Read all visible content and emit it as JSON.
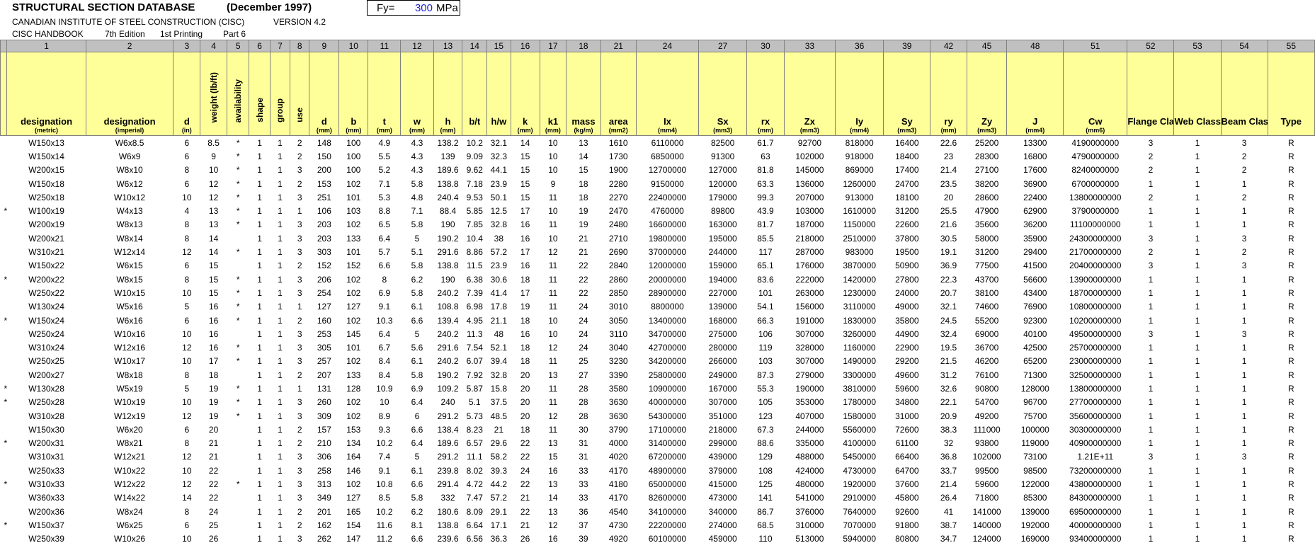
{
  "header": {
    "title": "STRUCTURAL SECTION DATABASE",
    "date": "(December 1997)",
    "org": "CANADIAN INSTITUTE OF STEEL CONSTRUCTION (CISC)",
    "version": "VERSION 4.2",
    "handbook": "CISC HANDBOOK",
    "edition": "7th Edition",
    "printing": "1st Printing",
    "part": "Part 6"
  },
  "fy": {
    "label": "Fy=",
    "value": "300",
    "unit": "MPa"
  },
  "columns": [
    {
      "num": "",
      "label": "",
      "unit": "",
      "w": 9
    },
    {
      "num": "1",
      "label": "designation",
      "unit": "(metric)",
      "w": 106
    },
    {
      "num": "2",
      "label": "designation",
      "unit": "(imperial)",
      "w": 118
    },
    {
      "num": "3",
      "label": "d",
      "unit": "(in)",
      "w": 36
    },
    {
      "num": "4",
      "label": "weight (lb/ft)",
      "unit": "",
      "w": 36,
      "v": true
    },
    {
      "num": "5",
      "label": "availability",
      "unit": "",
      "w": 30,
      "v": true
    },
    {
      "num": "6",
      "label": "shape",
      "unit": "",
      "w": 28,
      "v": true
    },
    {
      "num": "7",
      "label": "group",
      "unit": "",
      "w": 27,
      "v": true
    },
    {
      "num": "8",
      "label": "use",
      "unit": "",
      "w": 26,
      "v": true
    },
    {
      "num": "9",
      "label": "d",
      "unit": "(mm)",
      "w": 40
    },
    {
      "num": "10",
      "label": "b",
      "unit": "(mm)",
      "w": 39
    },
    {
      "num": "11",
      "label": "t",
      "unit": "(mm)",
      "w": 44
    },
    {
      "num": "12",
      "label": "w",
      "unit": "(mm)",
      "w": 44
    },
    {
      "num": "13",
      "label": "h",
      "unit": "(mm)",
      "w": 39
    },
    {
      "num": "14",
      "label": "b/t",
      "unit": "",
      "w": 33
    },
    {
      "num": "15",
      "label": "h/w",
      "unit": "",
      "w": 32
    },
    {
      "num": "16",
      "label": "k",
      "unit": "(mm)",
      "w": 39
    },
    {
      "num": "17",
      "label": "k1",
      "unit": "(mm)",
      "w": 36
    },
    {
      "num": "18",
      "label": "mass",
      "unit": "(kg/m)",
      "w": 46
    },
    {
      "num": "21",
      "label": "area",
      "unit": "(mm2)",
      "w": 48
    },
    {
      "num": "24",
      "label": "Ix",
      "unit": "(mm4)",
      "w": 84
    },
    {
      "num": "27",
      "label": "Sx",
      "unit": "(mm3)",
      "w": 65
    },
    {
      "num": "30",
      "label": "rx",
      "unit": "(mm)",
      "w": 50
    },
    {
      "num": "33",
      "label": "Zx",
      "unit": "(mm3)",
      "w": 69
    },
    {
      "num": "36",
      "label": "Iy",
      "unit": "(mm4)",
      "w": 65
    },
    {
      "num": "39",
      "label": "Sy",
      "unit": "(mm3)",
      "w": 63
    },
    {
      "num": "42",
      "label": "ry",
      "unit": "(mm)",
      "w": 49
    },
    {
      "num": "45",
      "label": "Zy",
      "unit": "(mm3)",
      "w": 54
    },
    {
      "num": "48",
      "label": "J",
      "unit": "(mm4)",
      "w": 76
    },
    {
      "num": "51",
      "label": "Cw",
      "unit": "(mm6)",
      "w": 86
    },
    {
      "num": "52",
      "label": "Flange Class",
      "unit": "",
      "w": 63
    },
    {
      "num": "53",
      "label": "Web Class",
      "unit": "",
      "w": 63
    },
    {
      "num": "54",
      "label": "Beam Class",
      "unit": "",
      "w": 63
    },
    {
      "num": "55",
      "label": "Type",
      "unit": "",
      "w": 63
    }
  ],
  "rows": [
    [
      "",
      "W150x13",
      "W6x8.5",
      "6",
      "8.5",
      "*",
      "1",
      "1",
      "2",
      "148",
      "100",
      "4.9",
      "4.3",
      "138.2",
      "10.2",
      "32.1",
      "14",
      "10",
      "13",
      "1610",
      "6110000",
      "82500",
      "61.7",
      "92700",
      "818000",
      "16400",
      "22.6",
      "25200",
      "13300",
      "4190000000",
      "3",
      "1",
      "3",
      "R"
    ],
    [
      "",
      "W150x14",
      "W6x9",
      "6",
      "9",
      "*",
      "1",
      "1",
      "2",
      "150",
      "100",
      "5.5",
      "4.3",
      "139",
      "9.09",
      "32.3",
      "15",
      "10",
      "14",
      "1730",
      "6850000",
      "91300",
      "63",
      "102000",
      "918000",
      "18400",
      "23",
      "28300",
      "16800",
      "4790000000",
      "2",
      "1",
      "2",
      "R"
    ],
    [
      "",
      "W200x15",
      "W8x10",
      "8",
      "10",
      "*",
      "1",
      "1",
      "3",
      "200",
      "100",
      "5.2",
      "4.3",
      "189.6",
      "9.62",
      "44.1",
      "15",
      "10",
      "15",
      "1900",
      "12700000",
      "127000",
      "81.8",
      "145000",
      "869000",
      "17400",
      "21.4",
      "27100",
      "17600",
      "8240000000",
      "2",
      "1",
      "2",
      "R"
    ],
    [
      "",
      "W150x18",
      "W6x12",
      "6",
      "12",
      "*",
      "1",
      "1",
      "2",
      "153",
      "102",
      "7.1",
      "5.8",
      "138.8",
      "7.18",
      "23.9",
      "15",
      "9",
      "18",
      "2280",
      "9150000",
      "120000",
      "63.3",
      "136000",
      "1260000",
      "24700",
      "23.5",
      "38200",
      "36900",
      "6700000000",
      "1",
      "1",
      "1",
      "R"
    ],
    [
      "",
      "W250x18",
      "W10x12",
      "10",
      "12",
      "*",
      "1",
      "1",
      "3",
      "251",
      "101",
      "5.3",
      "4.8",
      "240.4",
      "9.53",
      "50.1",
      "15",
      "11",
      "18",
      "2270",
      "22400000",
      "179000",
      "99.3",
      "207000",
      "913000",
      "18100",
      "20",
      "28600",
      "22400",
      "13800000000",
      "2",
      "1",
      "2",
      "R"
    ],
    [
      "*",
      "W100x19",
      "W4x13",
      "4",
      "13",
      "*",
      "1",
      "1",
      "1",
      "106",
      "103",
      "8.8",
      "7.1",
      "88.4",
      "5.85",
      "12.5",
      "17",
      "10",
      "19",
      "2470",
      "4760000",
      "89800",
      "43.9",
      "103000",
      "1610000",
      "31200",
      "25.5",
      "47900",
      "62900",
      "3790000000",
      "1",
      "1",
      "1",
      "R"
    ],
    [
      "",
      "W200x19",
      "W8x13",
      "8",
      "13",
      "*",
      "1",
      "1",
      "3",
      "203",
      "102",
      "6.5",
      "5.8",
      "190",
      "7.85",
      "32.8",
      "16",
      "11",
      "19",
      "2480",
      "16600000",
      "163000",
      "81.7",
      "187000",
      "1150000",
      "22600",
      "21.6",
      "35600",
      "36200",
      "11100000000",
      "1",
      "1",
      "1",
      "R"
    ],
    [
      "",
      "W200x21",
      "W8x14",
      "8",
      "14",
      "",
      "1",
      "1",
      "3",
      "203",
      "133",
      "6.4",
      "5",
      "190.2",
      "10.4",
      "38",
      "16",
      "10",
      "21",
      "2710",
      "19800000",
      "195000",
      "85.5",
      "218000",
      "2510000",
      "37800",
      "30.5",
      "58000",
      "35900",
      "24300000000",
      "3",
      "1",
      "3",
      "R"
    ],
    [
      "",
      "W310x21",
      "W12x14",
      "12",
      "14",
      "*",
      "1",
      "1",
      "3",
      "303",
      "101",
      "5.7",
      "5.1",
      "291.6",
      "8.86",
      "57.2",
      "17",
      "12",
      "21",
      "2690",
      "37000000",
      "244000",
      "117",
      "287000",
      "983000",
      "19500",
      "19.1",
      "31200",
      "29400",
      "21700000000",
      "2",
      "1",
      "2",
      "R"
    ],
    [
      "",
      "W150x22",
      "W6x15",
      "6",
      "15",
      "",
      "1",
      "1",
      "2",
      "152",
      "152",
      "6.6",
      "5.8",
      "138.8",
      "11.5",
      "23.9",
      "16",
      "11",
      "22",
      "2840",
      "12000000",
      "159000",
      "65.1",
      "176000",
      "3870000",
      "50900",
      "36.9",
      "77500",
      "41500",
      "20400000000",
      "3",
      "1",
      "3",
      "R"
    ],
    [
      "*",
      "W200x22",
      "W8x15",
      "8",
      "15",
      "*",
      "1",
      "1",
      "3",
      "206",
      "102",
      "8",
      "6.2",
      "190",
      "6.38",
      "30.6",
      "18",
      "11",
      "22",
      "2860",
      "20000000",
      "194000",
      "83.6",
      "222000",
      "1420000",
      "27800",
      "22.3",
      "43700",
      "56600",
      "13900000000",
      "1",
      "1",
      "1",
      "R"
    ],
    [
      "",
      "W250x22",
      "W10x15",
      "10",
      "15",
      "*",
      "1",
      "1",
      "3",
      "254",
      "102",
      "6.9",
      "5.8",
      "240.2",
      "7.39",
      "41.4",
      "17",
      "11",
      "22",
      "2850",
      "28900000",
      "227000",
      "101",
      "263000",
      "1230000",
      "24000",
      "20.7",
      "38100",
      "43400",
      "18700000000",
      "1",
      "1",
      "1",
      "R"
    ],
    [
      "",
      "W130x24",
      "W5x16",
      "5",
      "16",
      "*",
      "1",
      "1",
      "1",
      "127",
      "127",
      "9.1",
      "6.1",
      "108.8",
      "6.98",
      "17.8",
      "19",
      "11",
      "24",
      "3010",
      "8800000",
      "139000",
      "54.1",
      "156000",
      "3110000",
      "49000",
      "32.1",
      "74600",
      "76900",
      "10800000000",
      "1",
      "1",
      "1",
      "R"
    ],
    [
      "*",
      "W150x24",
      "W6x16",
      "6",
      "16",
      "*",
      "1",
      "1",
      "2",
      "160",
      "102",
      "10.3",
      "6.6",
      "139.4",
      "4.95",
      "21.1",
      "18",
      "10",
      "24",
      "3050",
      "13400000",
      "168000",
      "66.3",
      "191000",
      "1830000",
      "35800",
      "24.5",
      "55200",
      "92300",
      "10200000000",
      "1",
      "1",
      "1",
      "R"
    ],
    [
      "",
      "W250x24",
      "W10x16",
      "10",
      "16",
      "",
      "1",
      "1",
      "3",
      "253",
      "145",
      "6.4",
      "5",
      "240.2",
      "11.3",
      "48",
      "16",
      "10",
      "24",
      "3110",
      "34700000",
      "275000",
      "106",
      "307000",
      "3260000",
      "44900",
      "32.4",
      "69000",
      "40100",
      "49500000000",
      "3",
      "1",
      "3",
      "R"
    ],
    [
      "",
      "W310x24",
      "W12x16",
      "12",
      "16",
      "*",
      "1",
      "1",
      "3",
      "305",
      "101",
      "6.7",
      "5.6",
      "291.6",
      "7.54",
      "52.1",
      "18",
      "12",
      "24",
      "3040",
      "42700000",
      "280000",
      "119",
      "328000",
      "1160000",
      "22900",
      "19.5",
      "36700",
      "42500",
      "25700000000",
      "1",
      "1",
      "1",
      "R"
    ],
    [
      "",
      "W250x25",
      "W10x17",
      "10",
      "17",
      "*",
      "1",
      "1",
      "3",
      "257",
      "102",
      "8.4",
      "6.1",
      "240.2",
      "6.07",
      "39.4",
      "18",
      "11",
      "25",
      "3230",
      "34200000",
      "266000",
      "103",
      "307000",
      "1490000",
      "29200",
      "21.5",
      "46200",
      "65200",
      "23000000000",
      "1",
      "1",
      "1",
      "R"
    ],
    [
      "",
      "W200x27",
      "W8x18",
      "8",
      "18",
      "",
      "1",
      "1",
      "2",
      "207",
      "133",
      "8.4",
      "5.8",
      "190.2",
      "7.92",
      "32.8",
      "20",
      "13",
      "27",
      "3390",
      "25800000",
      "249000",
      "87.3",
      "279000",
      "3300000",
      "49600",
      "31.2",
      "76100",
      "71300",
      "32500000000",
      "1",
      "1",
      "1",
      "R"
    ],
    [
      "*",
      "W130x28",
      "W5x19",
      "5",
      "19",
      "*",
      "1",
      "1",
      "1",
      "131",
      "128",
      "10.9",
      "6.9",
      "109.2",
      "5.87",
      "15.8",
      "20",
      "11",
      "28",
      "3580",
      "10900000",
      "167000",
      "55.3",
      "190000",
      "3810000",
      "59600",
      "32.6",
      "90800",
      "128000",
      "13800000000",
      "1",
      "1",
      "1",
      "R"
    ],
    [
      "*",
      "W250x28",
      "W10x19",
      "10",
      "19",
      "*",
      "1",
      "1",
      "3",
      "260",
      "102",
      "10",
      "6.4",
      "240",
      "5.1",
      "37.5",
      "20",
      "11",
      "28",
      "3630",
      "40000000",
      "307000",
      "105",
      "353000",
      "1780000",
      "34800",
      "22.1",
      "54700",
      "96700",
      "27700000000",
      "1",
      "1",
      "1",
      "R"
    ],
    [
      "",
      "W310x28",
      "W12x19",
      "12",
      "19",
      "*",
      "1",
      "1",
      "3",
      "309",
      "102",
      "8.9",
      "6",
      "291.2",
      "5.73",
      "48.5",
      "20",
      "12",
      "28",
      "3630",
      "54300000",
      "351000",
      "123",
      "407000",
      "1580000",
      "31000",
      "20.9",
      "49200",
      "75700",
      "35600000000",
      "1",
      "1",
      "1",
      "R"
    ],
    [
      "",
      "W150x30",
      "W6x20",
      "6",
      "20",
      "",
      "1",
      "1",
      "2",
      "157",
      "153",
      "9.3",
      "6.6",
      "138.4",
      "8.23",
      "21",
      "18",
      "11",
      "30",
      "3790",
      "17100000",
      "218000",
      "67.3",
      "244000",
      "5560000",
      "72600",
      "38.3",
      "111000",
      "100000",
      "30300000000",
      "1",
      "1",
      "1",
      "R"
    ],
    [
      "*",
      "W200x31",
      "W8x21",
      "8",
      "21",
      "",
      "1",
      "1",
      "2",
      "210",
      "134",
      "10.2",
      "6.4",
      "189.6",
      "6.57",
      "29.6",
      "22",
      "13",
      "31",
      "4000",
      "31400000",
      "299000",
      "88.6",
      "335000",
      "4100000",
      "61100",
      "32",
      "93800",
      "119000",
      "40900000000",
      "1",
      "1",
      "1",
      "R"
    ],
    [
      "",
      "W310x31",
      "W12x21",
      "12",
      "21",
      "",
      "1",
      "1",
      "3",
      "306",
      "164",
      "7.4",
      "5",
      "291.2",
      "11.1",
      "58.2",
      "22",
      "15",
      "31",
      "4020",
      "67200000",
      "439000",
      "129",
      "488000",
      "5450000",
      "66400",
      "36.8",
      "102000",
      "73100",
      "1.21E+11",
      "3",
      "1",
      "3",
      "R"
    ],
    [
      "",
      "W250x33",
      "W10x22",
      "10",
      "22",
      "",
      "1",
      "1",
      "3",
      "258",
      "146",
      "9.1",
      "6.1",
      "239.8",
      "8.02",
      "39.3",
      "24",
      "16",
      "33",
      "4170",
      "48900000",
      "379000",
      "108",
      "424000",
      "4730000",
      "64700",
      "33.7",
      "99500",
      "98500",
      "73200000000",
      "1",
      "1",
      "1",
      "R"
    ],
    [
      "*",
      "W310x33",
      "W12x22",
      "12",
      "22",
      "*",
      "1",
      "1",
      "3",
      "313",
      "102",
      "10.8",
      "6.6",
      "291.4",
      "4.72",
      "44.2",
      "22",
      "13",
      "33",
      "4180",
      "65000000",
      "415000",
      "125",
      "480000",
      "1920000",
      "37600",
      "21.4",
      "59600",
      "122000",
      "43800000000",
      "1",
      "1",
      "1",
      "R"
    ],
    [
      "",
      "W360x33",
      "W14x22",
      "14",
      "22",
      "",
      "1",
      "1",
      "3",
      "349",
      "127",
      "8.5",
      "5.8",
      "332",
      "7.47",
      "57.2",
      "21",
      "14",
      "33",
      "4170",
      "82600000",
      "473000",
      "141",
      "541000",
      "2910000",
      "45800",
      "26.4",
      "71800",
      "85300",
      "84300000000",
      "1",
      "1",
      "1",
      "R"
    ],
    [
      "",
      "W200x36",
      "W8x24",
      "8",
      "24",
      "",
      "1",
      "1",
      "2",
      "201",
      "165",
      "10.2",
      "6.2",
      "180.6",
      "8.09",
      "29.1",
      "22",
      "13",
      "36",
      "4540",
      "34100000",
      "340000",
      "86.7",
      "376000",
      "7640000",
      "92600",
      "41",
      "141000",
      "139000",
      "69500000000",
      "1",
      "1",
      "1",
      "R"
    ],
    [
      "*",
      "W150x37",
      "W6x25",
      "6",
      "25",
      "",
      "1",
      "1",
      "2",
      "162",
      "154",
      "11.6",
      "8.1",
      "138.8",
      "6.64",
      "17.1",
      "21",
      "12",
      "37",
      "4730",
      "22200000",
      "274000",
      "68.5",
      "310000",
      "7070000",
      "91800",
      "38.7",
      "140000",
      "192000",
      "40000000000",
      "1",
      "1",
      "1",
      "R"
    ],
    [
      "",
      "W250x39",
      "W10x26",
      "10",
      "26",
      "",
      "1",
      "1",
      "3",
      "262",
      "147",
      "11.2",
      "6.6",
      "239.6",
      "6.56",
      "36.3",
      "26",
      "16",
      "39",
      "4920",
      "60100000",
      "459000",
      "110",
      "513000",
      "5940000",
      "80800",
      "34.7",
      "124000",
      "169000",
      "93400000000",
      "1",
      "1",
      "1",
      "R"
    ]
  ]
}
